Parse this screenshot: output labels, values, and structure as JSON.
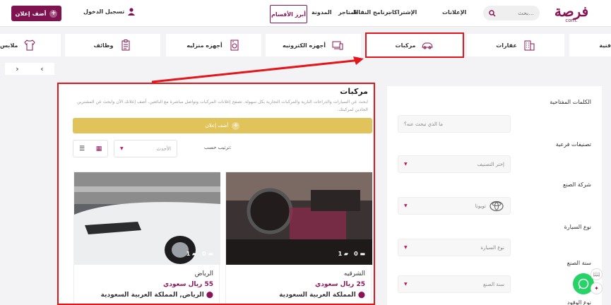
{
  "header": {
    "logo_text": "فرصة",
    "logo_sub": "com.",
    "search_placeholder": "بحث...",
    "nav": [
      "الإعلانات",
      "الإشتراكات",
      "برنامج النقاط",
      "المتاجر",
      "المدونة"
    ],
    "sections_label": "أبرز الأقسام",
    "login_label": "تسجيل الدخول",
    "add_ad_label": "أضف إعلان"
  },
  "categories": [
    "فنية",
    "عقارات",
    "مركبات",
    "أجهزه الكترونيه",
    "أجهزه منزليه",
    "وظائف",
    "ملابس"
  ],
  "pager": {
    "prev": "‹",
    "next": "›"
  },
  "main": {
    "title": "مركبات",
    "description": "ابحث عن السيارات والدراجات النارية والمركبات التجارية بكل سهولة. تصفح إعلانات المركبات وتواصل مباشرة مع البائعين. أضف إعلانك الآن وابحث عن المشترين الجادين لمركبتك.",
    "add_button": "أضف إعلان",
    "sort_label": "ترتيب حسب:",
    "sort_value": "الأحدث"
  },
  "listings": [
    {
      "city": "الشرقيه",
      "price": "25 ريال سعودي",
      "location": "المملكة العربية السعودية",
      "images": "1",
      "comments": "0"
    },
    {
      "city": "الرياض",
      "price": "55 ريال سعودي",
      "location": "الرياض, المملكة العربية السعودية",
      "images": "1",
      "comments": "0"
    }
  ],
  "sidebar": {
    "keywords_label": "الكلمات المفتاحية",
    "keywords_placeholder": "ما الذي تبحث عنه؟",
    "subcat_label": "تصنيفات فرعية",
    "subcat_value": "إختر التصنيف",
    "make_label": "شركة الصنع",
    "make_value": "تويوتا",
    "type_label": "نوع السيارة",
    "type_value": "نوع السيارة",
    "year_label": "سنة الصنع",
    "year_value": "سنة الصنع",
    "fuel_label": "نوع الوقود"
  },
  "colors": {
    "brand": "#8a1458",
    "accent_gold": "#e0c35a",
    "annotation_red": "#e3161b",
    "whatsapp": "#25d366"
  }
}
